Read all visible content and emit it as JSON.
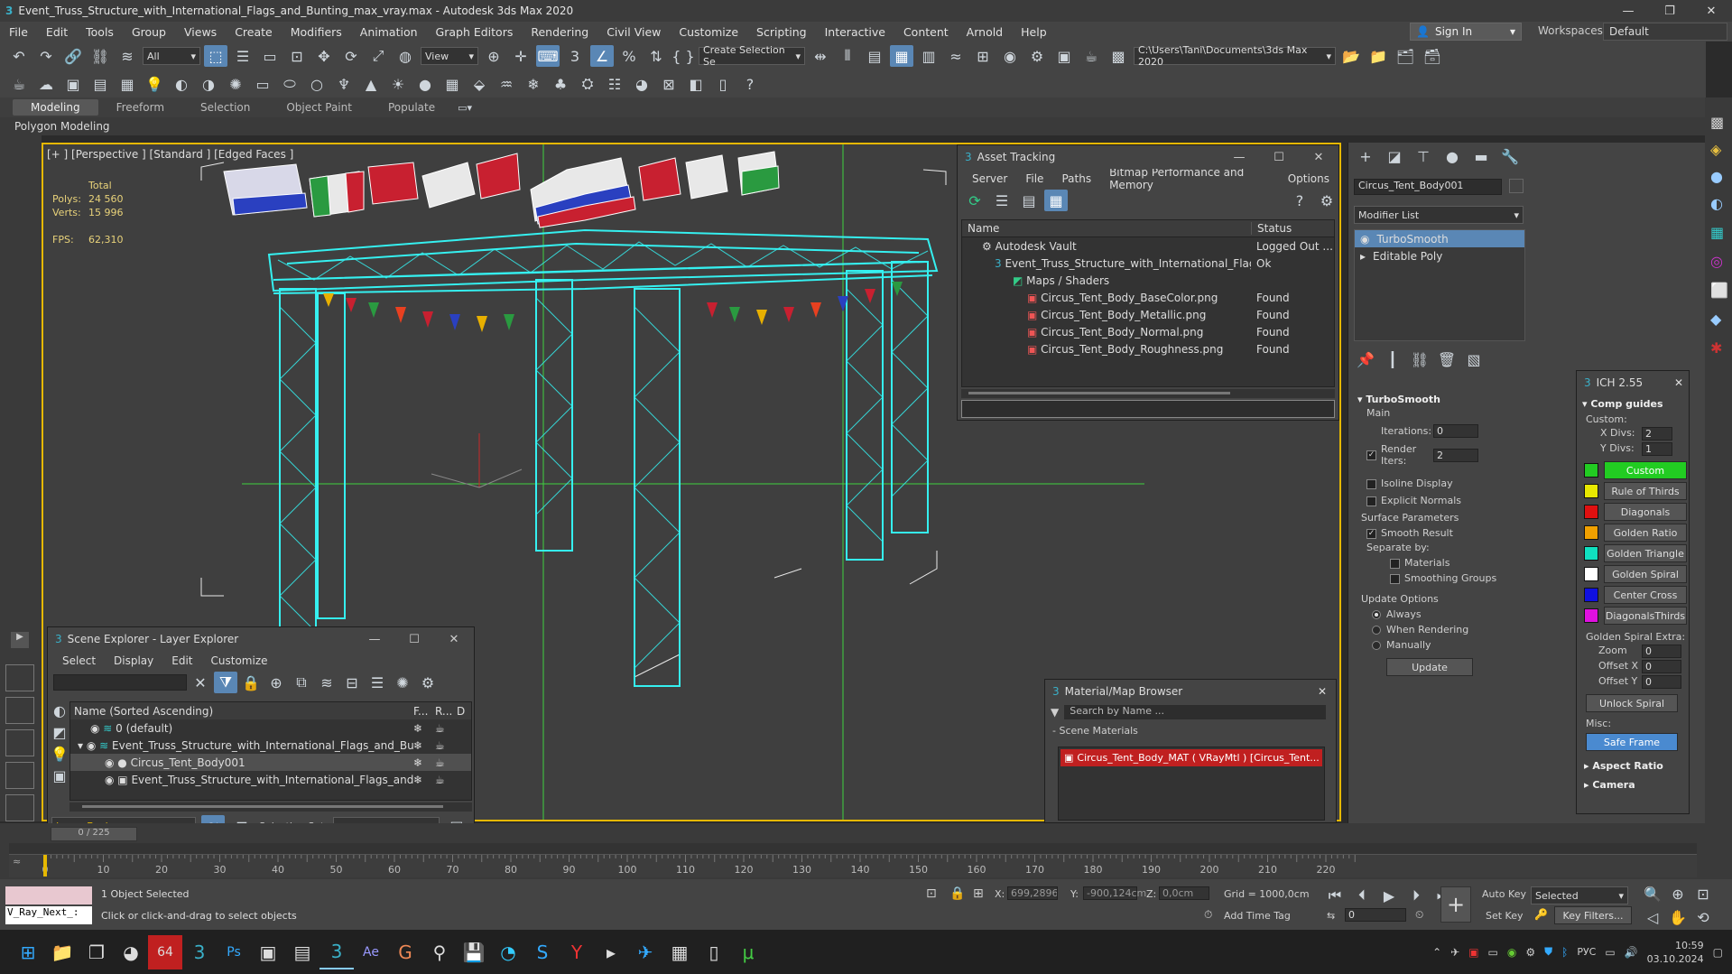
{
  "window": {
    "title": "Event_Truss_Structure_with_International_Flags_and_Bunting_max_vray.max - Autodesk 3ds Max 2020"
  },
  "menu": [
    "File",
    "Edit",
    "Tools",
    "Group",
    "Views",
    "Create",
    "Modifiers",
    "Animation",
    "Graph Editors",
    "Rendering",
    "Civil View",
    "Customize",
    "Scripting",
    "Interactive",
    "Content",
    "Arnold",
    "Help"
  ],
  "account": {
    "sign_in": "Sign In",
    "workspaces_label": "Workspaces:",
    "workspace": "Default"
  },
  "toolbar": {
    "filter": "All",
    "ref_coord": "View",
    "selection_set": "Create Selection Se",
    "project_path": "C:\\Users\\Tani\\Documents\\3ds Max 2020"
  },
  "ribbon": {
    "tabs": [
      "Modeling",
      "Freeform",
      "Selection",
      "Object Paint",
      "Populate"
    ],
    "sub": "Polygon Modeling"
  },
  "viewport": {
    "label": "[+ ] [Perspective ] [Standard ] [Edged Faces ]",
    "total_label": "Total",
    "polys_label": "Polys:",
    "polys": "24 560",
    "verts_label": "Verts:",
    "verts": "15 996",
    "fps_label": "FPS:",
    "fps": "62,310"
  },
  "asset_tracking": {
    "title": "Asset Tracking",
    "menu": [
      "Server",
      "File",
      "Paths",
      "Bitmap Performance and Memory",
      "Options"
    ],
    "col_name": "Name",
    "col_status": "Status",
    "rows": [
      {
        "name": "Autodesk Vault",
        "status": "Logged Out ..."
      },
      {
        "name": "Event_Truss_Structure_with_International_Flags_...",
        "status": "Ok"
      },
      {
        "name": "Maps / Shaders",
        "status": ""
      },
      {
        "name": "Circus_Tent_Body_BaseColor.png",
        "status": "Found"
      },
      {
        "name": "Circus_Tent_Body_Metallic.png",
        "status": "Found"
      },
      {
        "name": "Circus_Tent_Body_Normal.png",
        "status": "Found"
      },
      {
        "name": "Circus_Tent_Body_Roughness.png",
        "status": "Found"
      }
    ]
  },
  "scene_explorer": {
    "title": "Scene Explorer - Layer Explorer",
    "menu": [
      "Select",
      "Display",
      "Edit",
      "Customize"
    ],
    "col_name": "Name (Sorted Ascending)",
    "col_f": "F...",
    "col_r": "R...",
    "col_d": "D",
    "rows": [
      "0 (default)",
      "Event_Truss_Structure_with_International_Flags_and_Bunting",
      "Circus_Tent_Body001",
      "Event_Truss_Structure_with_International_Flags_and_Bunting"
    ],
    "footer_layer": "Layer Explorer",
    "footer_selset": "Selection Set:"
  },
  "material_browser": {
    "title": "Material/Map Browser",
    "search": "Search by Name ...",
    "section": "- Scene Materials",
    "item": "Circus_Tent_Body_MAT ( VRayMtl ) [Circus_Tent..."
  },
  "command_panel": {
    "object_name": "Circus_Tent_Body001",
    "modifier_list": "Modifier List",
    "stack": [
      "TurboSmooth",
      "Editable Poly"
    ],
    "turbosmooth": {
      "title": "TurboSmooth",
      "main": "Main",
      "iterations_label": "Iterations:",
      "iterations": "0",
      "render_iters_label": "Render Iters:",
      "render_iters": "2",
      "isoline": "Isoline Display",
      "explicit": "Explicit Normals",
      "surface": "Surface Parameters",
      "smooth": "Smooth Result",
      "separate": "Separate by:",
      "materials": "Materials",
      "smoothing": "Smoothing Groups",
      "update_opts": "Update Options",
      "always": "Always",
      "when_rendering": "When Rendering",
      "manually": "Manually",
      "update": "Update"
    }
  },
  "ich": {
    "title": "ICH 2.55",
    "comp_guides": "Comp guides",
    "custom_label": "Custom:",
    "xdivs_label": "X Divs:",
    "xdivs": "2",
    "ydivs_label": "Y Divs:",
    "ydivs": "1",
    "guides": [
      {
        "label": "Custom",
        "color": "#22cc22"
      },
      {
        "label": "Rule of Thirds",
        "color": "#e8e800"
      },
      {
        "label": "Diagonals",
        "color": "#e01010"
      },
      {
        "label": "Golden Ratio",
        "color": "#f0a000"
      },
      {
        "label": "Golden Triangle",
        "color": "#10e0c0"
      },
      {
        "label": "Golden Spiral",
        "color": "#ffffff"
      },
      {
        "label": "Center Cross",
        "color": "#1010e0"
      },
      {
        "label": "DiagonalsThirds",
        "color": "#e010e0"
      }
    ],
    "spiral_extra": "Golden Spiral Extra:",
    "zoom_label": "Zoom",
    "zoom": "0",
    "offx_label": "Offset X",
    "offx": "0",
    "offy_label": "Offset Y",
    "offy": "0",
    "unlock": "Unlock Spiral",
    "misc": "Misc:",
    "safe_frame": "Safe Frame",
    "aspect": "Aspect Ratio",
    "camera": "Camera"
  },
  "timeline": {
    "ticks": [
      "0",
      "10",
      "20",
      "30",
      "40",
      "50",
      "60",
      "70",
      "80",
      "90",
      "100",
      "110",
      "120",
      "130",
      "140",
      "150",
      "160",
      "170",
      "180",
      "190",
      "200",
      "210",
      "220"
    ],
    "frame_counter": "0 / 225"
  },
  "statusbar": {
    "script": "V_Ray_Next_:",
    "selected": "1 Object Selected",
    "hint": "Click or click-and-drag to select objects",
    "x_label": "X:",
    "x": "699,2896cr",
    "y_label": "Y:",
    "y": "-900,124cm",
    "z_label": "Z:",
    "z": "0,0cm",
    "grid": "Grid = 1000,0cm",
    "add_time_tag": "Add Time Tag",
    "frame": "0",
    "auto_key": "Auto Key",
    "set_key": "Set Key",
    "key_mode": "Selected",
    "key_filters": "Key Filters..."
  },
  "taskbar": {
    "lang": "РУС",
    "time": "10:59",
    "date": "03.10.2024"
  }
}
